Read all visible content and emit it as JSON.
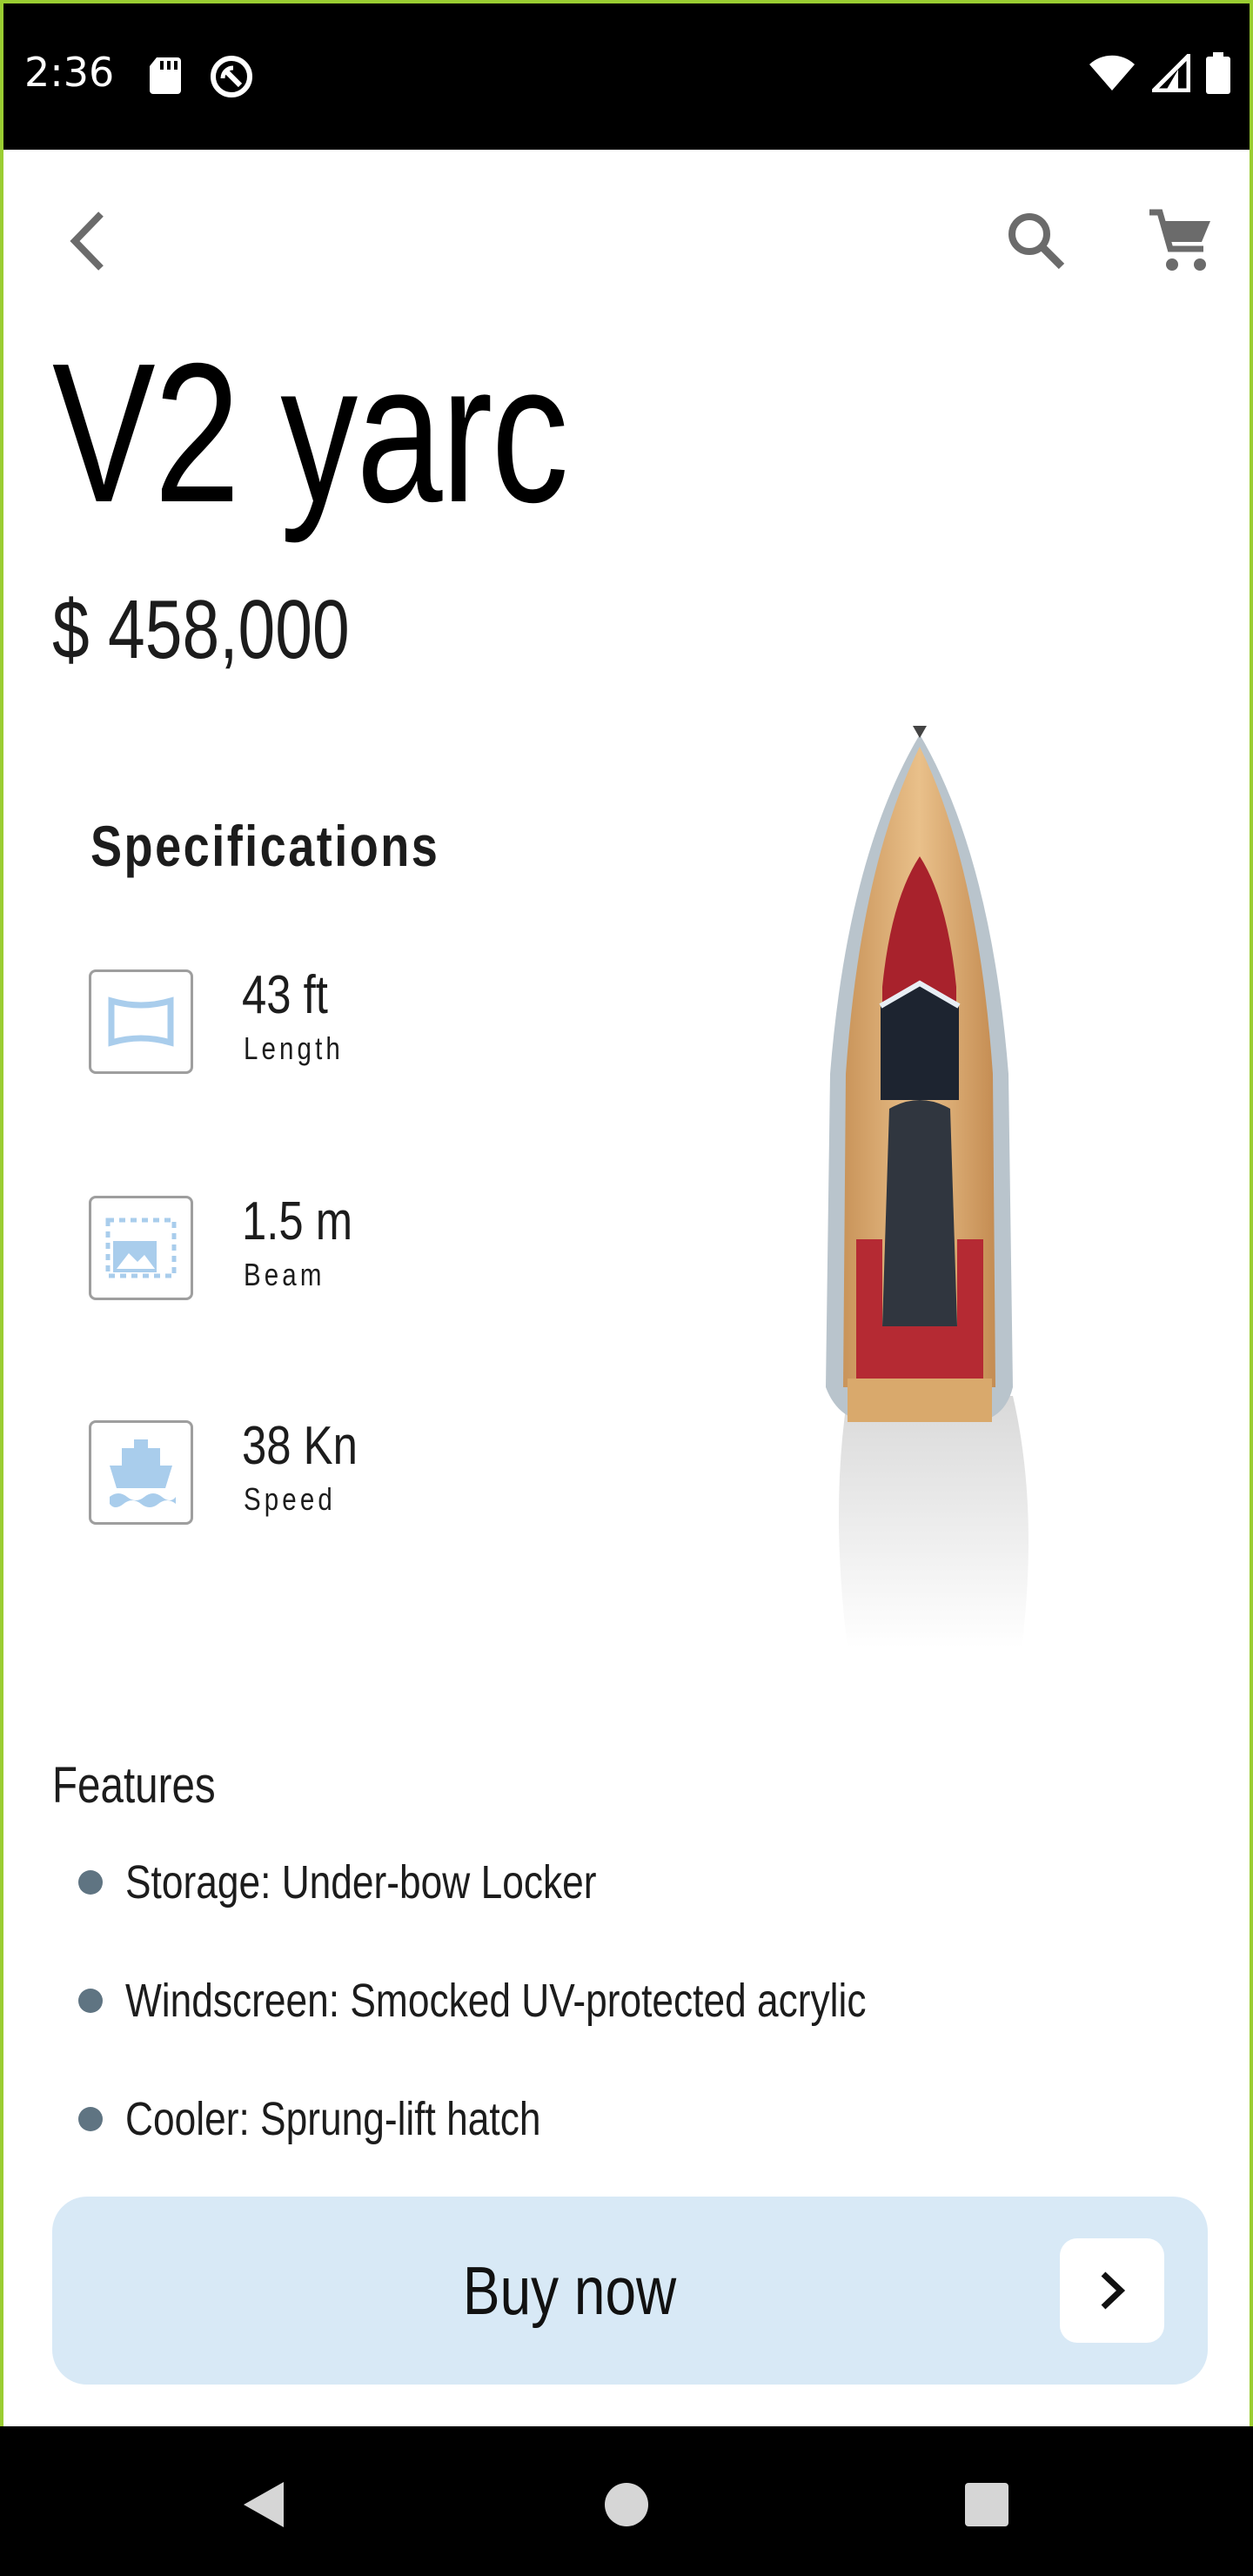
{
  "status_bar": {
    "time": "2:36",
    "icons": [
      "sd-card-icon",
      "no-disturb-icon",
      "wifi-icon",
      "signal-icon",
      "battery-icon"
    ]
  },
  "navbar": {
    "icons": [
      "back-arrow-icon",
      "search-icon",
      "cart-icon"
    ]
  },
  "product": {
    "title": "V2 yarc",
    "price": "$ 458,000"
  },
  "specifications": {
    "title": "Specifications",
    "items": [
      {
        "value": "43 ft",
        "label": "Length",
        "icon": "length-icon"
      },
      {
        "value": "1.5 m",
        "label": "Beam",
        "icon": "beam-icon"
      },
      {
        "value": "38 Kn",
        "label": "Speed",
        "icon": "boat-icon"
      }
    ]
  },
  "features": {
    "title": "Features",
    "items": [
      "Storage: Under-bow Locker",
      "Windscreen: Smocked UV-protected acrylic",
      "Cooler: Sprung-lift hatch"
    ]
  },
  "cta": {
    "label": "Buy now"
  },
  "colors": {
    "accent_light": "#d8e9f6",
    "icon_blue": "#a9cdec",
    "bullet": "#5f7482",
    "frame": "#9acd32"
  }
}
